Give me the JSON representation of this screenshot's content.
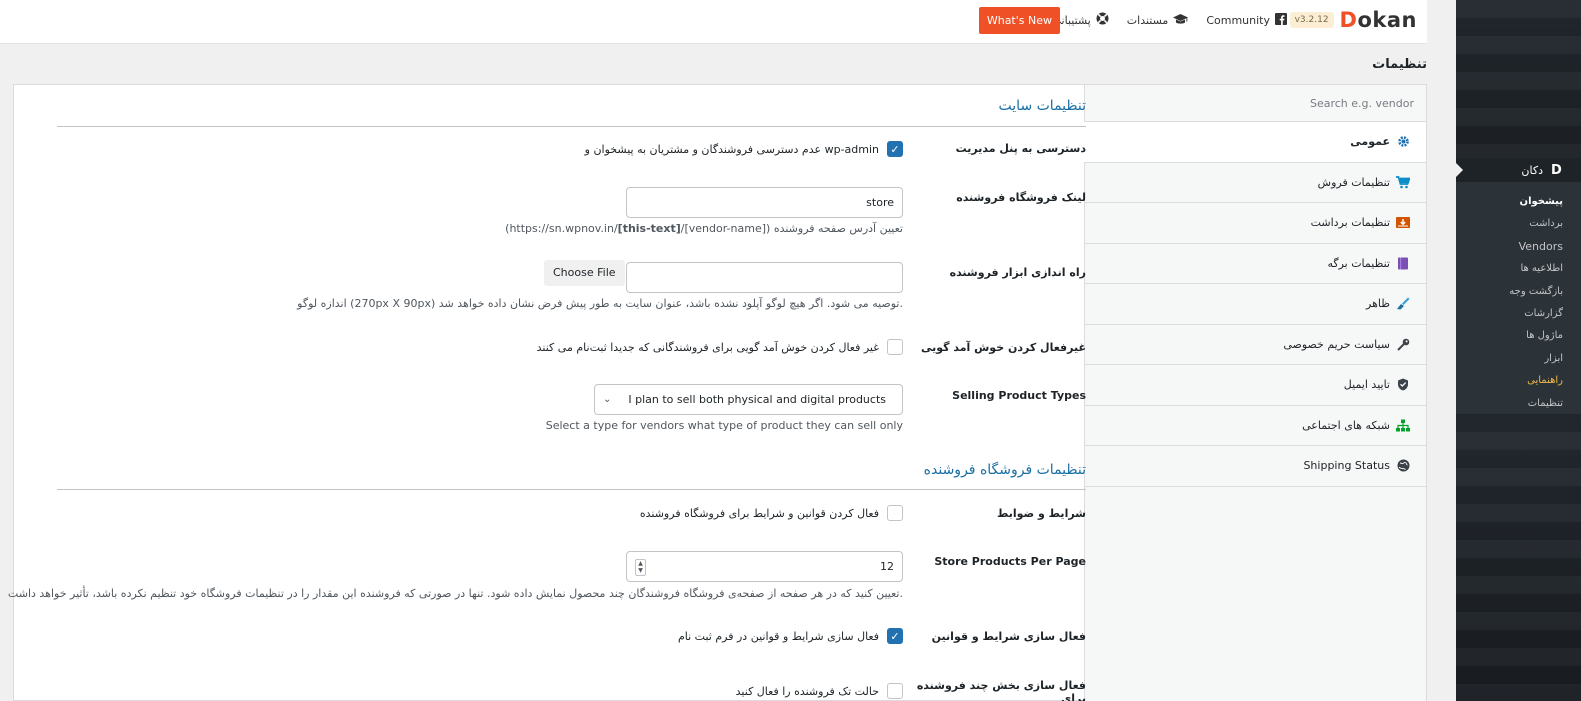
{
  "header": {
    "brand_name": "Dokan",
    "version": "v3.2.12",
    "links": [
      {
        "label": "Community",
        "icon": "facebook-icon"
      },
      {
        "label": "مستندات",
        "icon": "graduation-cap-icon"
      },
      {
        "label": "پشتیبانی",
        "icon": "lifebuoy-icon"
      }
    ],
    "whats_new": "What's New"
  },
  "page_title": "تنظیمات",
  "tabs": {
    "search_placeholder": "Search e.g. vendor",
    "items": [
      {
        "label": "عمومی",
        "icon": "gear-icon",
        "color": "#2271b1"
      },
      {
        "label": "تنظیمات فروش",
        "icon": "cart-icon",
        "color": "#0b8dc7"
      },
      {
        "label": "تنظیمات برداشت",
        "icon": "withdraw-icon",
        "color": "#d63638"
      },
      {
        "label": "تنظیمات برگه",
        "icon": "book-icon",
        "color": "#7b4fb3"
      },
      {
        "label": "ظاهر",
        "icon": "brush-icon",
        "color": "#1a6fa3"
      },
      {
        "label": "سیاست حریم خصوصی",
        "icon": "key-icon",
        "color": "#3c434a"
      },
      {
        "label": "تایید ایمیل",
        "icon": "shield-icon",
        "color": "#3c434a"
      },
      {
        "label": "شبکه های اجتماعی",
        "icon": "network-icon",
        "color": "#00a32a"
      },
      {
        "label": "Shipping Status",
        "icon": "globe-icon",
        "color": "#3c434a"
      }
    ]
  },
  "sections": {
    "site_settings": "تنظیمات سایت",
    "vendor_store_settings": "تنظیمات فروشگاه فروشنده"
  },
  "fields": {
    "admin_access": {
      "label": "دسترسی به پنل مدیریت",
      "checkbox_label": "عدم دسترسی فروشندگان و مشتریان به پیشخوان و wp-admin",
      "checked": true
    },
    "vendor_store_url": {
      "label": "لینک فروشگاه فروشنده",
      "value": "store",
      "desc_prefix": "تعیین آدرس صفحه فروشنده",
      "desc_url_start": "(https://sn.wpnov.in/",
      "desc_url_bold": "[this-text]",
      "desc_url_end": "/[vendor-name])"
    },
    "setup_wizard_logo": {
      "label": "راه اندازی ابزار فروشنده",
      "button": "Choose File",
      "desc": "اندازه لوگو (270px X 90px) توصیه می شود. اگر هیچ لوگو آپلود نشده باشد، عنوان سایت به طور پیش فرض نشان داده خواهد شد."
    },
    "disable_welcome_wizard": {
      "label": "غیرفعال کردن خوش آمد گویی",
      "checkbox_label": "غیر فعال کردن خوش آمد گویی برای فروشندگانی که جدیدا ثبت‌نام می کنند",
      "checked": false
    },
    "selling_product_types": {
      "label": "Selling Product Types",
      "value": "I plan to sell both physical and digital products",
      "desc": "Select a type for vendors what type of product they can sell only"
    },
    "terms_conditions": {
      "label": "شرایط و ضوابط",
      "checkbox_label": "فعال کردن قوانین و شرایط برای فروشگاه فروشنده",
      "checked": false
    },
    "store_products_per_page": {
      "label": "Store Products Per Page",
      "value": "12",
      "desc": "تعیین کنید که در هر صفحه از صفحه‌ی فروشگاه فروشندگان چند محصول نمایش داده شود. تنها در صورتی که فروشنده این مقدار را در تنظیمات فروشگاه خود تنظیم نکرده باشد، تأثیر خواهد داشت."
    },
    "enable_terms_registration": {
      "label": "فعال سازی شرایط و قوانین",
      "checkbox_label": "فعال سازی شرایط و قوانین در فرم ثبت نام",
      "checked": true
    },
    "single_seller_mode": {
      "label": "فعال سازی بخش چند فروشنده برای",
      "checkbox_label": "حالت تک فروشنده را فعال کنید",
      "checked": false
    }
  },
  "wp_sidebar": {
    "menu_title": "دکان",
    "items": [
      {
        "label": "پیشخوان",
        "state": "active"
      },
      {
        "label": "برداشت",
        "state": "normal"
      },
      {
        "label": "Vendors",
        "state": "normal"
      },
      {
        "label": "اطلاعیه ها",
        "state": "normal"
      },
      {
        "label": "بازگشت وجه",
        "state": "normal"
      },
      {
        "label": "گزارشات",
        "state": "normal"
      },
      {
        "label": "ماژول ها",
        "state": "normal"
      },
      {
        "label": "ابزار",
        "state": "normal"
      },
      {
        "label": "راهنمایی",
        "state": "highlight"
      },
      {
        "label": "تنظیمات",
        "state": "normal"
      }
    ]
  },
  "colors": {
    "accent": "#f05025",
    "checkbox_on": "#2271b1",
    "section_heading": "#1a6fa3"
  }
}
